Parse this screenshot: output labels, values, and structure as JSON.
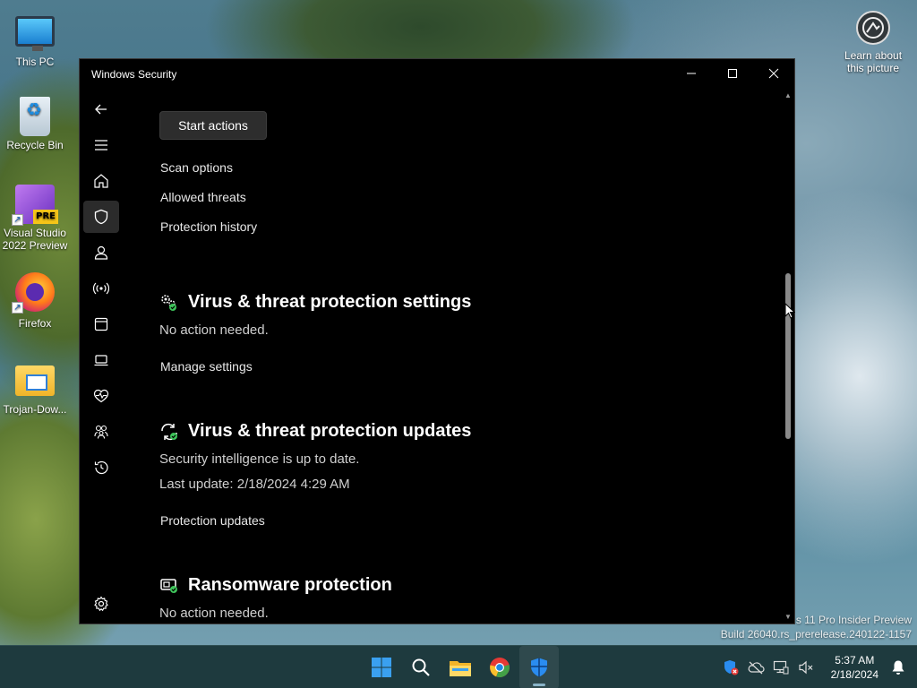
{
  "desktop": {
    "icons": [
      {
        "label": "This PC"
      },
      {
        "label": "Recycle Bin"
      },
      {
        "label": "Visual Studio 2022 Preview",
        "badge": "PRE"
      },
      {
        "label": "Firefox"
      },
      {
        "label": "Trojan-Dow..."
      }
    ],
    "learn_label": "Learn about this picture",
    "watermark_line1": "s 11 Pro Insider Preview",
    "watermark_line2": "Build 26040.rs_prerelease.240122-1157"
  },
  "window": {
    "title": "Windows Security"
  },
  "content": {
    "start_actions": "Start actions",
    "links_top": [
      "Scan options",
      "Allowed threats",
      "Protection history"
    ],
    "settings": {
      "heading": "Virus & threat protection settings",
      "status": "No action needed.",
      "link": "Manage settings"
    },
    "updates": {
      "heading": "Virus & threat protection updates",
      "status": "Security intelligence is up to date.",
      "last_update": "Last update: 2/18/2024 4:29 AM",
      "link": "Protection updates"
    },
    "ransomware": {
      "heading": "Ransomware protection",
      "status": "No action needed."
    }
  },
  "taskbar": {
    "time": "5:37 AM",
    "date": "2/18/2024"
  },
  "colors": {
    "window_bg": "#000000",
    "taskbar_bg": "#1e3a3e",
    "accent_green": "#3ec35a",
    "shield_blue": "#2a8cf0"
  }
}
